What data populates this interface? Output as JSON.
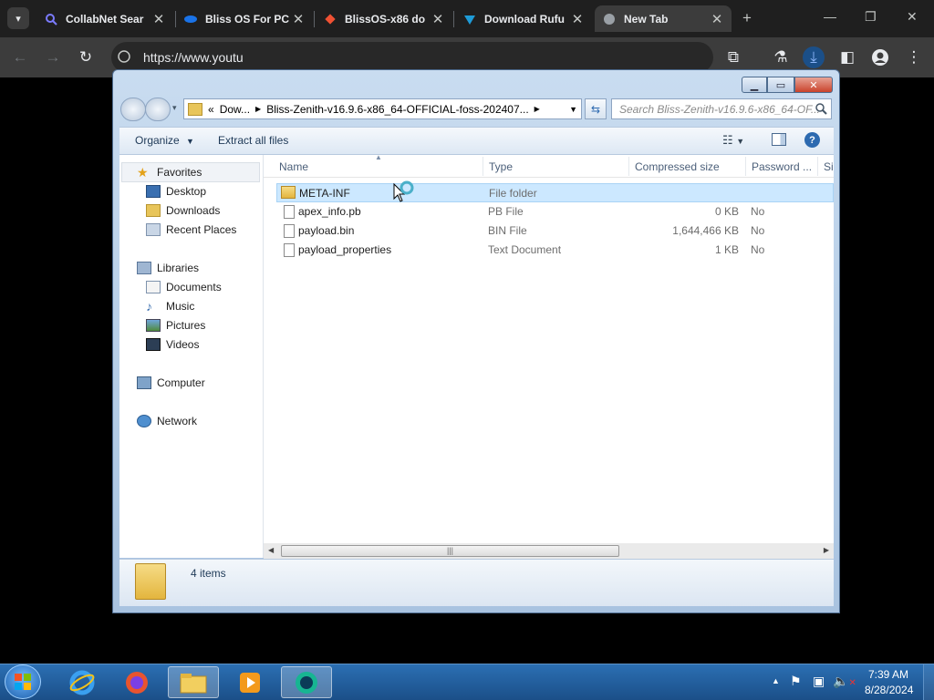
{
  "browser": {
    "tabs": [
      {
        "title": "CollabNet Sear",
        "icon": "magnifier-icon",
        "color": "#6b6bff"
      },
      {
        "title": "Bliss OS For PC",
        "icon": "bliss-icon",
        "color": "#1a73e8"
      },
      {
        "title": "BlissOS-x86 do",
        "icon": "git-icon",
        "color": "#f05133"
      },
      {
        "title": "Download Rufu",
        "icon": "rufus-icon",
        "color": "#1e9bd7"
      },
      {
        "title": "New Tab",
        "icon": "globe-icon",
        "color": "#9aa0a6"
      }
    ],
    "url": "https://www.youtu"
  },
  "explorer": {
    "breadcrumb": {
      "part1": "Dow...",
      "part2": "Bliss-Zenith-v16.9.6-x86_64-OFFICIAL-foss-202407..."
    },
    "search_placeholder": "Search Bliss-Zenith-v16.9.6-x86_64-OF...",
    "commands": {
      "organize": "Organize",
      "extract_all": "Extract all files"
    },
    "nav": {
      "favorites": "Favorites",
      "desktop": "Desktop",
      "downloads": "Downloads",
      "recent": "Recent Places",
      "libraries": "Libraries",
      "documents": "Documents",
      "music": "Music",
      "pictures": "Pictures",
      "videos": "Videos",
      "computer": "Computer",
      "network": "Network"
    },
    "columns": {
      "name": "Name",
      "type": "Type",
      "compressed": "Compressed size",
      "password": "Password ...",
      "size": "Si"
    },
    "files": [
      {
        "name": "META-INF",
        "type": "File folder",
        "compressed": "",
        "password": "",
        "kind": "folder"
      },
      {
        "name": "apex_info.pb",
        "type": "PB File",
        "compressed": "0 KB",
        "password": "No",
        "kind": "file"
      },
      {
        "name": "payload.bin",
        "type": "BIN File",
        "compressed": "1,644,466 KB",
        "password": "No",
        "kind": "file"
      },
      {
        "name": "payload_properties",
        "type": "Text Document",
        "compressed": "1 KB",
        "password": "No",
        "kind": "file"
      }
    ],
    "status": "4 items"
  },
  "taskbar": {
    "time": "7:39 AM",
    "date": "8/28/2024"
  },
  "colors": {
    "selection": "#cce8ff",
    "taskbar": "#1f5a98",
    "chrome_bg": "#1f1f1f"
  }
}
